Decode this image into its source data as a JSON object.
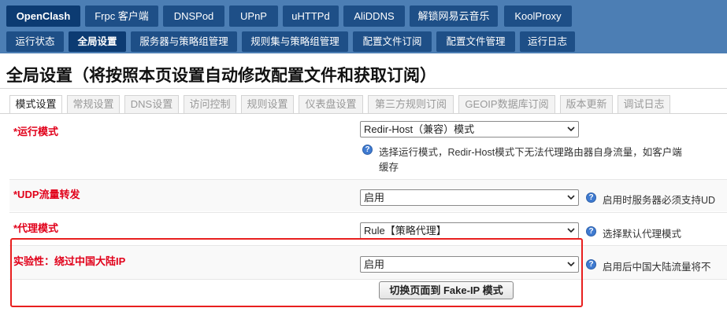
{
  "top_tabs": [
    "OpenClash",
    "Frpc 客户端",
    "DNSPod",
    "UPnP",
    "uHTTPd",
    "AliDDNS",
    "解锁网易云音乐",
    "KoolProxy"
  ],
  "sub_tabs": [
    "运行状态",
    "全局设置",
    "服务器与策略组管理",
    "规则集与策略组管理",
    "配置文件订阅",
    "配置文件管理",
    "运行日志"
  ],
  "page_title": "全局设置（将按照本页设置自动修改配置文件和获取订阅）",
  "content_tabs": [
    "模式设置",
    "常规设置",
    "DNS设置",
    "访问控制",
    "规则设置",
    "仪表盘设置",
    "第三方规则订阅",
    "GEOIP数据库订阅",
    "版本更新",
    "调试日志"
  ],
  "fields": {
    "run_mode": {
      "label": "*运行模式",
      "value": "Redir-Host（兼容）模式",
      "desc_line1": "选择运行模式，Redir-Host模式下无法代理路由器自身流量，如客户端",
      "desc_line2": "缓存"
    },
    "udp": {
      "label": "*UDP流量转发",
      "value": "启用",
      "desc": "启用时服务器必须支持UD"
    },
    "proxy_mode": {
      "label": "*代理模式",
      "value": "Rule【策略代理】",
      "desc": "选择默认代理模式"
    },
    "bypass_china": {
      "label": "实验性：绕过中国大陆IP",
      "value": "启用",
      "desc": "启用后中国大陆流量将不"
    }
  },
  "fakeip_button_label": "切换页面到 Fake-IP 模式",
  "colors": {
    "nav_bg": "#4c7eb4",
    "tab_bg": "#1e4f87",
    "label_red": "#e1001a",
    "highlight_box": "#e8201f",
    "info_blue": "#3f7bd1"
  },
  "icons": {
    "info": "info-icon",
    "select_arrow": "chevron-down-icon"
  }
}
